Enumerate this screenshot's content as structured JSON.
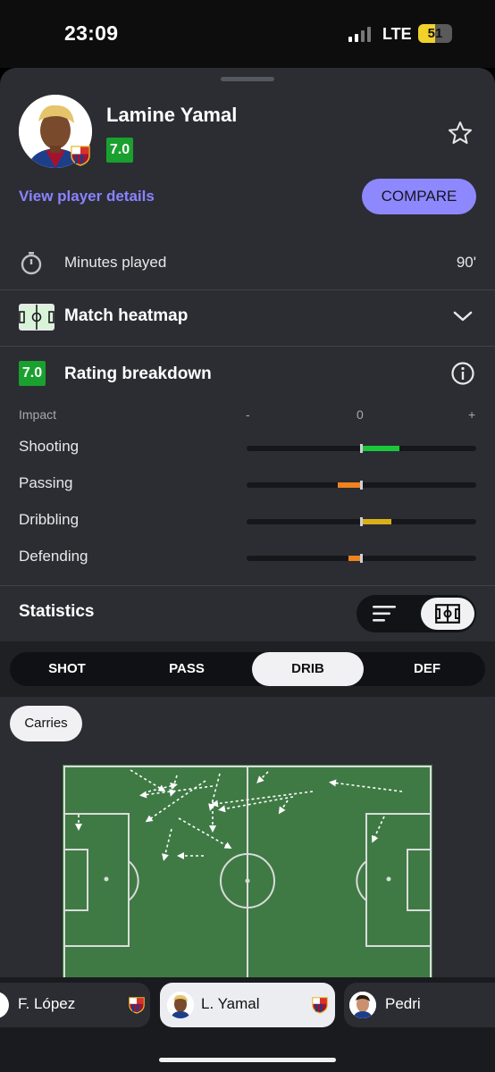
{
  "status_bar": {
    "time": "23:09",
    "network": "LTE",
    "battery": "51",
    "battery_level": 0.51
  },
  "player": {
    "name": "Lamine Yamal",
    "rating": "7.0",
    "view_details_label": "View player details",
    "compare_label": "COMPARE"
  },
  "minutes": {
    "label": "Minutes played",
    "value": "90'"
  },
  "heatmap": {
    "label": "Match heatmap"
  },
  "rating_breakdown": {
    "label": "Rating breakdown",
    "rating": "7.0",
    "impact_label": "Impact",
    "scale_minus": "-",
    "scale_zero": "0",
    "scale_plus": "+",
    "categories": [
      {
        "label": "Shooting",
        "impact": 0.32,
        "color": "#1ac93b"
      },
      {
        "label": "Passing",
        "impact": -0.2,
        "color": "#f0831e"
      },
      {
        "label": "Dribbling",
        "impact": 0.25,
        "color": "#d9b01a"
      },
      {
        "label": "Defending",
        "impact": -0.11,
        "color": "#f0831e"
      }
    ]
  },
  "statistics": {
    "label": "Statistics",
    "tabs": [
      "SHOT",
      "PASS",
      "DRIB",
      "DEF"
    ],
    "active_tab": "DRIB",
    "filter": "Carries"
  },
  "player_switcher": [
    {
      "name": "F. López"
    },
    {
      "name": "L. Yamal",
      "active": true
    },
    {
      "name": "Pedri"
    }
  ],
  "colors": {
    "accent": "#8e88ff",
    "rating_green": "#1aa02e",
    "pitch": "#3f7a45",
    "sheet": "#2b2d33"
  }
}
